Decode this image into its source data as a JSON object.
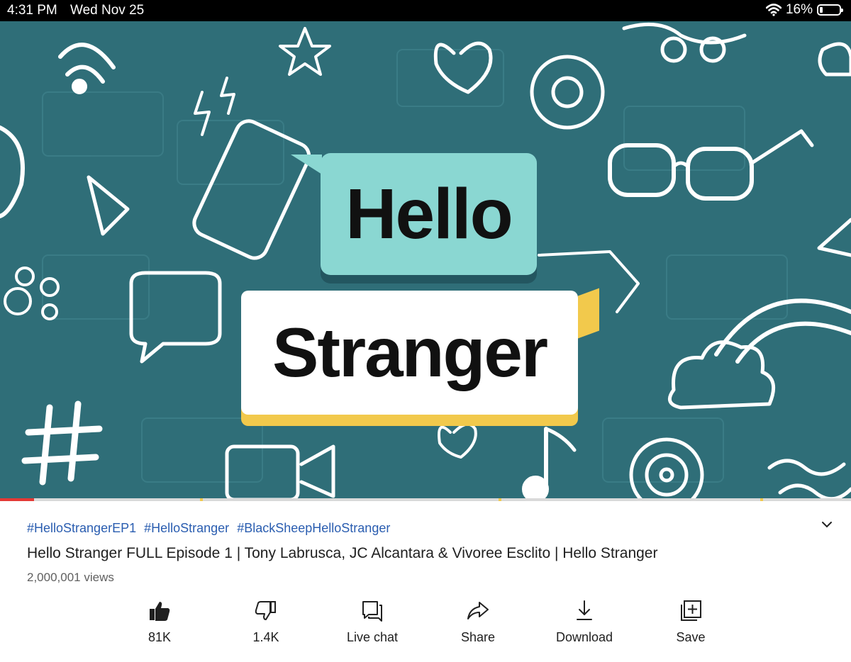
{
  "status_bar": {
    "time": "4:31 PM",
    "date": "Wed Nov 25",
    "battery": "16%",
    "battery_level": 0.16
  },
  "video": {
    "thumbnail_line1": "Hello",
    "thumbnail_line2": "Stranger",
    "progress": 0.04
  },
  "details": {
    "hashtags": [
      "#HelloStrangerEP1",
      "#HelloStranger",
      "#BlackSheepHelloStranger"
    ],
    "title": "Hello Stranger FULL Episode 1 | Tony Labrusca, JC Alcantara & Vivoree Esclito | Hello Stranger",
    "views": "2,000,001 views"
  },
  "actions": [
    {
      "icon": "thumbs-up-icon",
      "label": "81K"
    },
    {
      "icon": "thumbs-down-icon",
      "label": "1.4K"
    },
    {
      "icon": "live-chat-icon",
      "label": "Live chat"
    },
    {
      "icon": "share-icon",
      "label": "Share"
    },
    {
      "icon": "download-icon",
      "label": "Download"
    },
    {
      "icon": "save-icon",
      "label": "Save"
    }
  ],
  "colors": {
    "video_bg": "#2f6e78",
    "hashtag": "#2a5db0",
    "progress_played": "#e53935",
    "accent_yellow": "#f2c94c"
  }
}
